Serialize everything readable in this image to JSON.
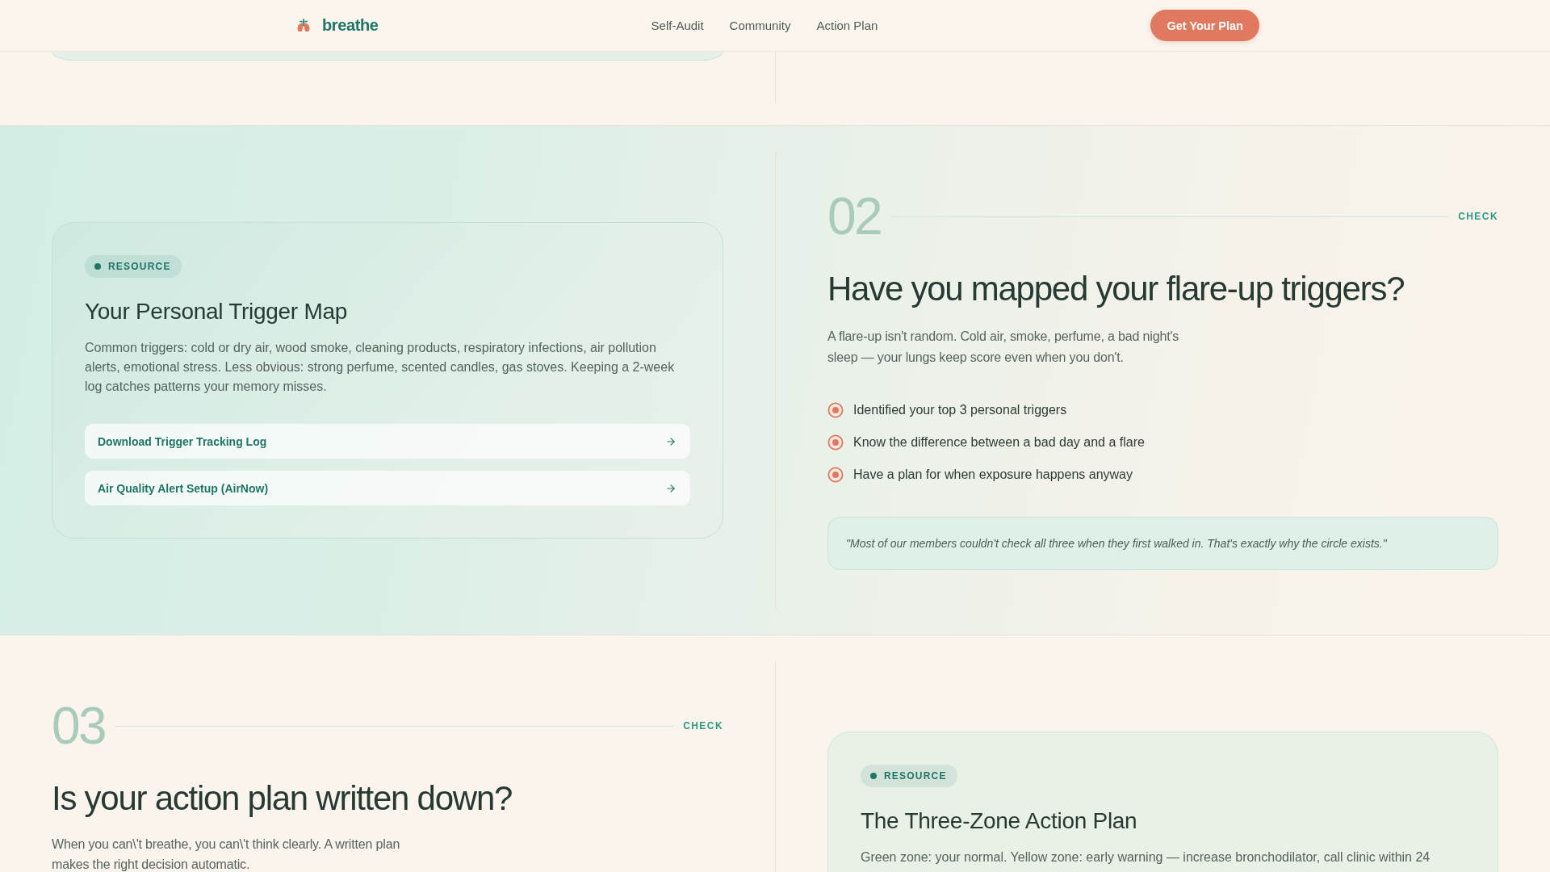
{
  "header": {
    "logo": "breathe",
    "nav": [
      {
        "label": "Self-Audit"
      },
      {
        "label": "Community"
      },
      {
        "label": "Action Plan"
      }
    ],
    "cta": "Get Your Plan"
  },
  "sections": [
    {
      "kind": "mirrored",
      "tinted": true,
      "question": {
        "number": "02",
        "tag": "CHECK",
        "heading": "Have you mapped your flare-up triggers?",
        "intro": "A flare-up isn't random. Cold air, smoke, perfume, a bad night's sleep — your lungs keep score even when you don't.",
        "checklist": [
          "Identified your top 3 personal triggers",
          "Know the difference between a bad day and a flare",
          "Have a plan for when exposure happens anyway"
        ],
        "quote": "\"Most of our members couldn't check all three when they first walked in. That's exactly why the circle exists.\""
      },
      "resource": {
        "badge": "RESOURCE",
        "title": "Your Personal Trigger Map",
        "body": "Common triggers: cold or dry air, wood smoke, cleaning products, respiratory infections, air pollution alerts, emotional stress. Less obvious: strong perfume, scented candles, gas stoves. Keeping a 2-week log catches patterns your memory misses.",
        "links": [
          {
            "label": "Download Trigger Tracking Log"
          },
          {
            "label": "Air Quality Alert Setup (AirNow)"
          }
        ]
      }
    },
    {
      "kind": "regular",
      "tinted": false,
      "question": {
        "number": "03",
        "tag": "CHECK",
        "heading": "Is your action plan written down?",
        "intro": "When you can\\'t breathe, you can\\'t think clearly. A written plan makes the right decision automatic."
      },
      "resource": {
        "badge": "RESOURCE",
        "title": "The Three-Zone Action Plan",
        "body": "Green zone: your normal. Yellow zone: early warning — increase bronchodilator, call clinic within 24"
      }
    }
  ]
}
